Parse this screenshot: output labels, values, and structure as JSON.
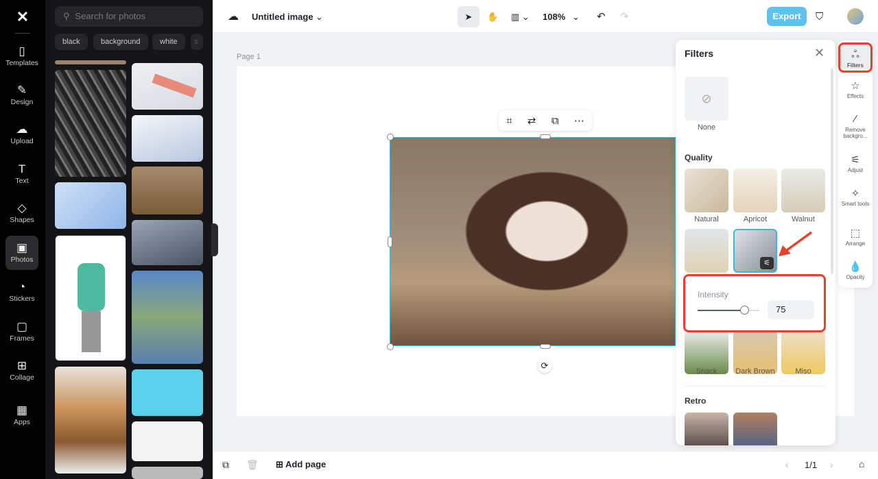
{
  "sidebar": {
    "items": [
      {
        "label": "Templates",
        "icon": "templates-icon"
      },
      {
        "label": "Design",
        "icon": "design-icon"
      },
      {
        "label": "Upload",
        "icon": "upload-icon"
      },
      {
        "label": "Text",
        "icon": "text-icon"
      },
      {
        "label": "Shapes",
        "icon": "shapes-icon"
      },
      {
        "label": "Photos",
        "icon": "photos-icon",
        "active": true
      },
      {
        "label": "Stickers",
        "icon": "stickers-icon"
      },
      {
        "label": "Frames",
        "icon": "frames-icon"
      },
      {
        "label": "Collage",
        "icon": "collage-icon"
      },
      {
        "label": "Apps",
        "icon": "apps-icon"
      }
    ]
  },
  "photos": {
    "search_placeholder": "Search for photos",
    "chips": [
      "black",
      "background",
      "white",
      "s"
    ]
  },
  "header": {
    "title": "Untitled image",
    "zoom": "108%",
    "export": "Export"
  },
  "canvas": {
    "page_label": "Page 1"
  },
  "filters": {
    "title": "Filters",
    "none": "None",
    "quality_heading": "Quality",
    "quality": [
      "Natural",
      "Apricot",
      "Walnut"
    ],
    "more": [
      "Snack",
      "Dark Brown",
      "Miso"
    ],
    "retro_heading": "Retro",
    "intensity_label": "Intensity",
    "intensity_value": "75",
    "intensity_fraction": 0.75
  },
  "right_rail": {
    "items": [
      "Filters",
      "Effects",
      "Remove backgro...",
      "Adjust",
      "Smart tools",
      "Arrange",
      "Opacity"
    ]
  },
  "footer": {
    "add_page": "Add page",
    "page_count": "1/1"
  },
  "colors": {
    "accent": "#5cc2ef",
    "highlight": "#e8402a",
    "selection": "#3bb7d8"
  }
}
